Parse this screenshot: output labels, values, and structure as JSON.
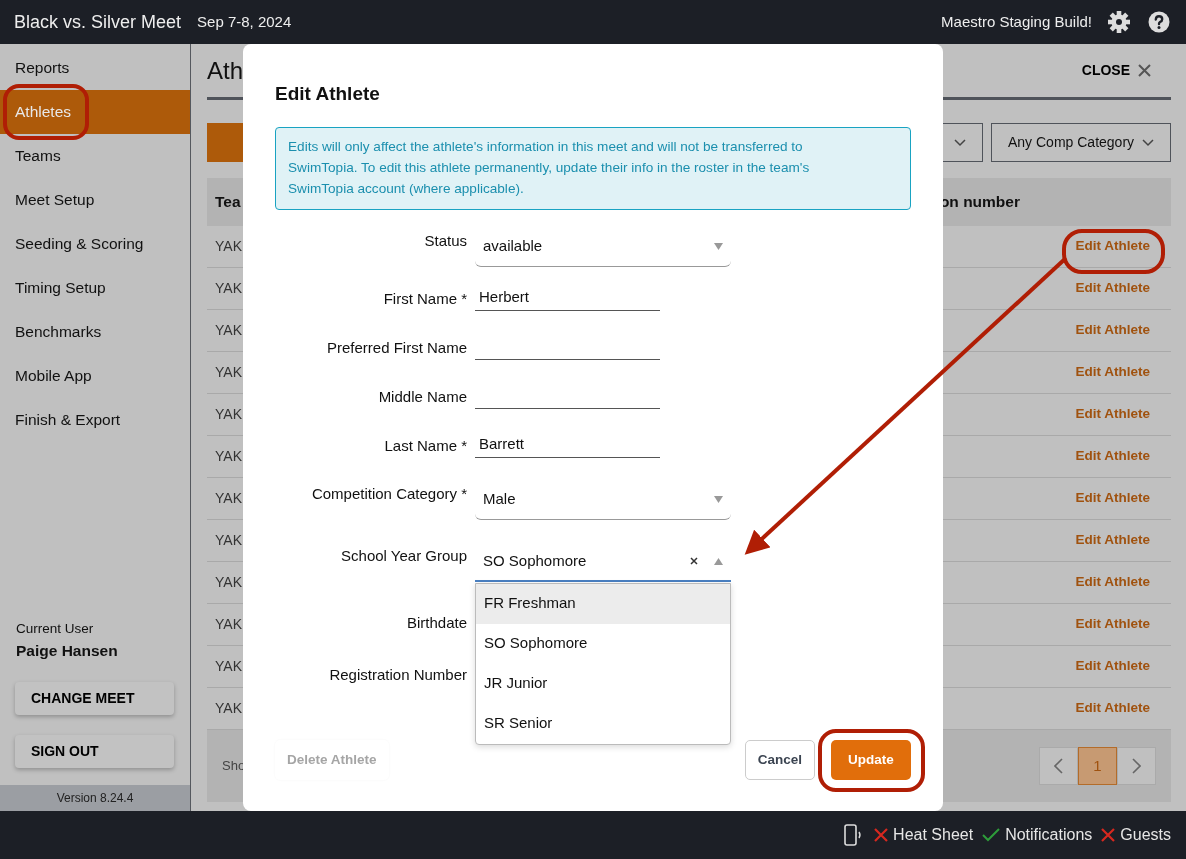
{
  "app": {
    "title": "Black vs. Silver Meet",
    "dates": "Sep 7-8, 2024",
    "build": "Maestro Staging Build!"
  },
  "sidebar": {
    "items": [
      {
        "label": "Reports",
        "selected": false
      },
      {
        "label": "Athletes",
        "selected": true
      },
      {
        "label": "Teams",
        "selected": false
      },
      {
        "label": "Meet Setup",
        "selected": false
      },
      {
        "label": "Seeding & Scoring",
        "selected": false
      },
      {
        "label": "Timing Setup",
        "selected": false
      },
      {
        "label": "Benchmarks",
        "selected": false
      },
      {
        "label": "Mobile App",
        "selected": false
      },
      {
        "label": "Finish & Export",
        "selected": false
      }
    ],
    "current_user_label": "Current User",
    "current_user": "Paige Hansen",
    "buttons": [
      "CHANGE MEET",
      "SIGN OUT"
    ],
    "version": "Version 8.24.4"
  },
  "page": {
    "title": "Ath",
    "close": "CLOSE",
    "filter": "Any Comp Category",
    "table": {
      "columns": [
        "Tea",
        "on number"
      ],
      "rows": [
        {
          "team": "YAK",
          "action": "Edit Athlete"
        },
        {
          "team": "YAK",
          "action": "Edit Athlete"
        },
        {
          "team": "YAK",
          "action": "Edit Athlete"
        },
        {
          "team": "YAK",
          "action": "Edit Athlete"
        },
        {
          "team": "YAK",
          "action": "Edit Athlete"
        },
        {
          "team": "YAK",
          "action": "Edit Athlete"
        },
        {
          "team": "YAK",
          "action": "Edit Athlete"
        },
        {
          "team": "YAK",
          "action": "Edit Athlete"
        },
        {
          "team": "YAK",
          "action": "Edit Athlete"
        },
        {
          "team": "YAK",
          "action": "Edit Athlete"
        },
        {
          "team": "YAK",
          "action": "Edit Athlete"
        },
        {
          "team": "YAK",
          "action": "Edit Athlete"
        }
      ]
    },
    "footer_text": "Sho",
    "pagination": [
      {
        "label": "1",
        "selected": true
      }
    ]
  },
  "modal": {
    "title": "Edit Athlete",
    "notice": "Edits will only affect the athlete's information in this meet and will not be transferred to SwimTopia. To edit this athlete permanently, update their info in the roster in the team's SwimTopia account (where applicable).",
    "fields": [
      {
        "kind": "select",
        "label": "Status",
        "value": "available"
      },
      {
        "kind": "text",
        "label": "First Name *",
        "value": "Herbert"
      },
      {
        "kind": "text",
        "label": "Preferred First Name"
      },
      {
        "kind": "text",
        "label": "Middle Name"
      },
      {
        "kind": "text",
        "label": "Last Name *",
        "value": "Barrett"
      },
      {
        "kind": "select",
        "label": "Competition Category *",
        "value": "Male"
      },
      {
        "kind": "combo",
        "label": "School Year Group",
        "value": "SO Sophomore",
        "expanded": true,
        "options": [
          {
            "label": "FR Freshman",
            "highlighted": true
          },
          {
            "label": "SO Sophomore",
            "highlighted": false
          },
          {
            "label": "JR Junior",
            "highlighted": false
          },
          {
            "label": "SR Senior",
            "highlighted": false
          }
        ]
      },
      {
        "kind": "text",
        "label": "Birthdate"
      },
      {
        "kind": "text",
        "label": "Registration Number"
      }
    ],
    "buttons": [
      {
        "kind": "delete",
        "label": "Delete Athlete",
        "disabled": true
      },
      {
        "kind": "cancel",
        "label": "Cancel",
        "disabled": false
      },
      {
        "kind": "primary",
        "label": "Update",
        "disabled": false
      }
    ]
  },
  "status_bar": [
    {
      "label": "Heat Sheet",
      "ok": false
    },
    {
      "label": "Notifications",
      "ok": true
    },
    {
      "label": "Guests",
      "ok": false
    }
  ]
}
